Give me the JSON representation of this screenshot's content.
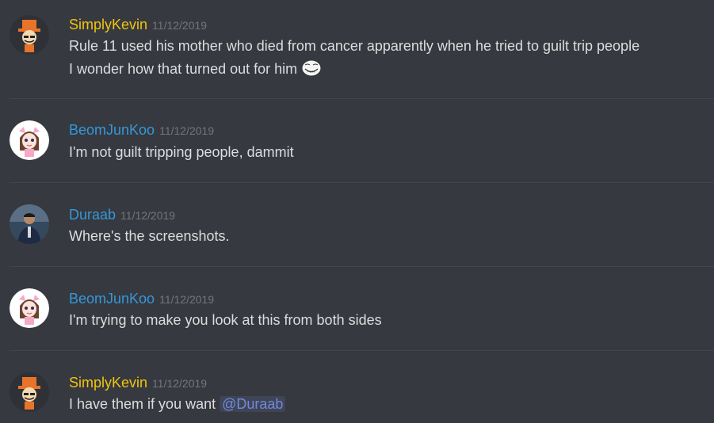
{
  "colors": {
    "background": "#36393f",
    "text": "#dcddde",
    "timestamp": "#72767d",
    "mention": "#7289da",
    "name_simplykevin": "#f1c40f",
    "name_beomjunkoo": "#3498db",
    "name_duraab": "#3498db"
  },
  "messages": [
    {
      "author": "SimplyKevin",
      "timestamp": "11/12/2019",
      "avatar_icon": "orange-top-hat-troll-avatar-icon",
      "lines": [
        "Rule 11 used his mother who died from cancer apparently when he tried to guilt trip people",
        "I wonder how that turned out for him"
      ],
      "emoji": "trollface-emoji"
    },
    {
      "author": "BeomJunKoo",
      "timestamp": "11/12/2019",
      "avatar_icon": "anime-girl-avatar-icon",
      "lines": [
        "I'm not guilt tripping people, dammit"
      ]
    },
    {
      "author": "Duraab",
      "timestamp": "11/12/2019",
      "avatar_icon": "photo-person-avatar-icon",
      "lines": [
        "Where's the screenshots."
      ]
    },
    {
      "author": "BeomJunKoo",
      "timestamp": "11/12/2019",
      "avatar_icon": "anime-girl-avatar-icon",
      "lines": [
        "I'm trying to make you look at this from both sides"
      ]
    },
    {
      "author": "SimplyKevin",
      "timestamp": "11/12/2019",
      "avatar_icon": "orange-top-hat-troll-avatar-icon",
      "lines": [
        "I have them if you want "
      ],
      "mention": "@Duraab"
    }
  ]
}
